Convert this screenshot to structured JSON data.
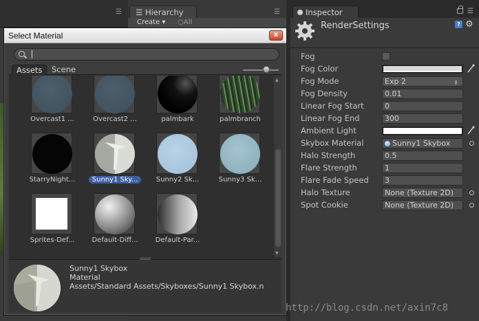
{
  "background": {
    "hierarchy_tab": "Hierarchy",
    "create_label": "Create ▾",
    "search_all": "All"
  },
  "dialog": {
    "title": "Select Material",
    "close_label": "x",
    "search_value": "",
    "tabs": [
      "Assets",
      "Scene"
    ],
    "zoom_level": 0.7,
    "materials": [
      {
        "label": "Overcast1 ...",
        "style": "overcast"
      },
      {
        "label": "Overcast2 ...",
        "style": "overcast"
      },
      {
        "label": "palmbark",
        "style": "palmbark"
      },
      {
        "label": "palmbranch",
        "style": "palmbranch"
      },
      {
        "label": "StarryNight...",
        "style": "starry"
      },
      {
        "label": "Sunny1 Sky...",
        "style": "sunny1",
        "selected": true
      },
      {
        "label": "Sunny2 Sk...",
        "style": "sunny2"
      },
      {
        "label": "Sunny3 Sk...",
        "style": "sunny3"
      },
      {
        "label": "Sprites-Def...",
        "style": "sprite"
      },
      {
        "label": "Default-Diff...",
        "style": "diffuse"
      },
      {
        "label": "Default-Par...",
        "style": "particle"
      }
    ],
    "preview": {
      "name": "Sunny1 Skybox",
      "type": "Material",
      "path": "Assets/Standard Assets/Skyboxes/Sunny1 Skybox.n"
    }
  },
  "inspector": {
    "tab_label": "Inspector",
    "title": "RenderSettings",
    "properties": [
      {
        "label": "Fog",
        "kind": "checkbox",
        "checked": false
      },
      {
        "label": "Fog Color",
        "kind": "color",
        "color": "#d9d9d9"
      },
      {
        "label": "Fog Mode",
        "kind": "dropdown",
        "value": "Exp 2"
      },
      {
        "label": "Fog Density",
        "kind": "text",
        "value": "0.01"
      },
      {
        "label": "Linear Fog Start",
        "kind": "text",
        "value": "0"
      },
      {
        "label": "Linear Fog End",
        "kind": "text",
        "value": "300"
      },
      {
        "label": "Ambient Light",
        "kind": "color",
        "color": "#ffffff"
      },
      {
        "label": "Skybox Material",
        "kind": "object",
        "value": "Sunny1 Skybox",
        "icon": "material-ball-icon"
      },
      {
        "label": "Halo Strength",
        "kind": "text",
        "value": "0.5"
      },
      {
        "label": "Flare Strength",
        "kind": "text",
        "value": "1"
      },
      {
        "label": "Flare Fade Speed",
        "kind": "text",
        "value": "3"
      },
      {
        "label": "Halo Texture",
        "kind": "object",
        "value": "None (Texture 2D)"
      },
      {
        "label": "Spot Cookie",
        "kind": "object",
        "value": "None (Texture 2D)"
      }
    ]
  },
  "watermark": "http://blog.csdn.net/axin7c8",
  "colors": {
    "selection": "#3d5f9e",
    "close_button": "#c7472c",
    "help_icon": "#4d7ac5"
  }
}
